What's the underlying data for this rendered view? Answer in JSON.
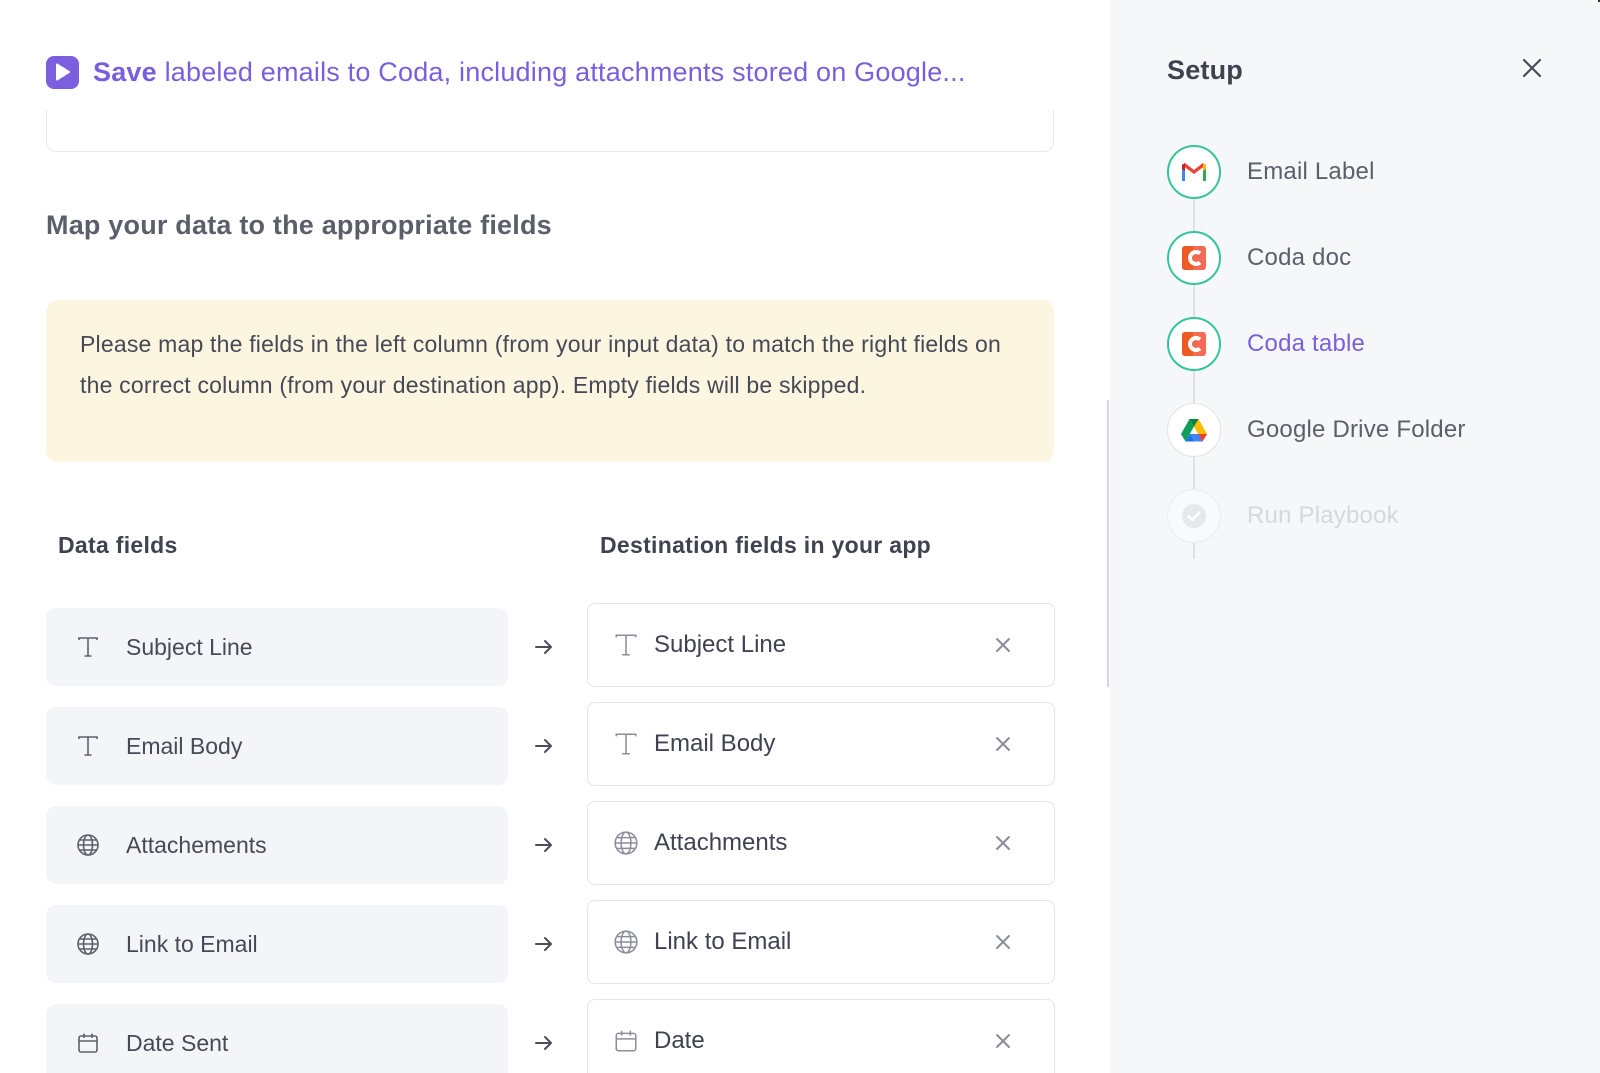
{
  "header": {
    "title_strong": "Save",
    "title_rest": "labeled emails to Coda, including attachments stored on Google..."
  },
  "mapping": {
    "section_title": "Map your data to the appropriate fields",
    "notice": "Please map the fields in the left column (from your input data) to match the right fields on the correct column (from your destination app). Empty fields will be skipped.",
    "data_fields_header": "Data fields",
    "destination_header": "Destination fields in your app",
    "rows": [
      {
        "source": "Subject Line",
        "source_icon": "text-type-icon",
        "destination": "Subject Line",
        "destination_icon": "text-type-icon"
      },
      {
        "source": "Email Body",
        "source_icon": "text-type-icon",
        "destination": "Email Body",
        "destination_icon": "text-type-icon"
      },
      {
        "source": "Attachements",
        "source_icon": "globe-icon",
        "destination": "Attachments",
        "destination_icon": "globe-icon"
      },
      {
        "source": "Link to Email",
        "source_icon": "globe-icon",
        "destination": "Link to Email",
        "destination_icon": "globe-icon"
      },
      {
        "source": "Date Sent",
        "source_icon": "calendar-icon",
        "destination": "Date",
        "destination_icon": "calendar-icon"
      }
    ]
  },
  "setup": {
    "title": "Setup",
    "steps": [
      {
        "label": "Email Label",
        "icon": "gmail-icon",
        "state": "done"
      },
      {
        "label": "Coda doc",
        "icon": "coda-icon",
        "state": "done"
      },
      {
        "label": "Coda table",
        "icon": "coda-icon",
        "state": "active"
      },
      {
        "label": "Google Drive Folder",
        "icon": "google-drive-icon",
        "state": "pending"
      },
      {
        "label": "Run Playbook",
        "icon": "check-circle-icon",
        "state": "disabled"
      }
    ]
  },
  "colors": {
    "accent": "#7a5fdc",
    "success": "#35c59a",
    "notice_bg": "#fcf5e0",
    "sidebar_bg": "#f6f7f9"
  }
}
